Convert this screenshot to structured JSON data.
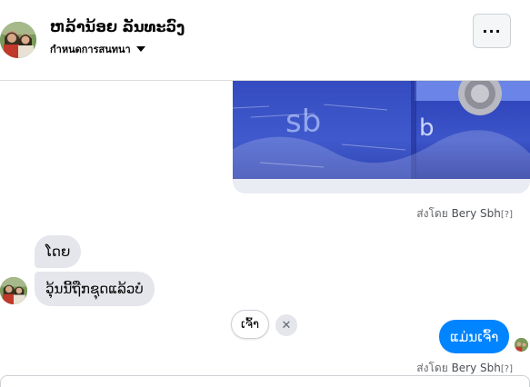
{
  "header": {
    "contact_name": "ຫລ້ານ້ອຍ ລັນທະວົງ",
    "settings_label": "กำหนดการสนทนา",
    "more_label": "···"
  },
  "messages": {
    "sent_by_prefix": "ส่งโดย ",
    "sent_by_name": "Bery Sbh",
    "sent_by_help": "[?]",
    "received_1": "ໂດຍ",
    "received_2": "ວຸ້ນນີ້ຖືກຊຸດແລ້ວບໍ",
    "sent_1": "ແມ່ນເຈົ້າ"
  },
  "quick_reply": {
    "label": "ເຈົ້າ",
    "dismiss": "✕"
  },
  "colors": {
    "sent_bubble": "#0084ff",
    "received_bubble": "#e4e6eb"
  }
}
